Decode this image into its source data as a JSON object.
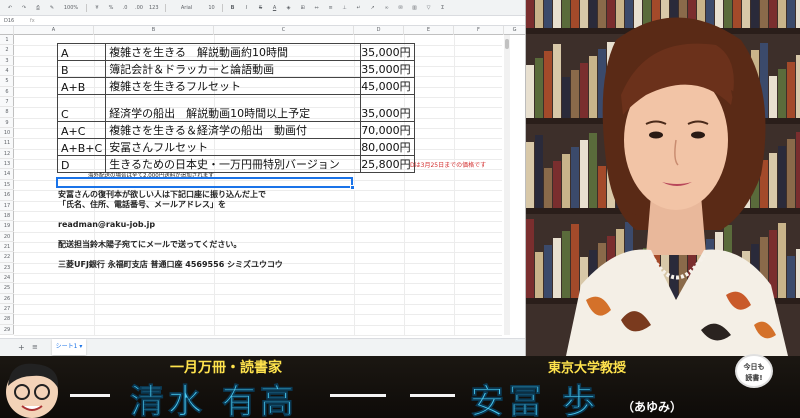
{
  "toolbar": {
    "zoom": "100%",
    "currency": "¥",
    "percent": "%",
    "decimals": ".0",
    "decimals_more": ".00",
    "format": "123",
    "font": "Arial",
    "font_size": "10"
  },
  "formula_bar": {
    "cell_ref": "D16",
    "fx": "fx"
  },
  "columns": [
    "A",
    "B",
    "C",
    "D",
    "E",
    "F",
    "G"
  ],
  "rows": [
    "1",
    "2",
    "3",
    "4",
    "5",
    "6",
    "7",
    "8",
    "9",
    "10",
    "11",
    "12",
    "13",
    "14",
    "15",
    "16",
    "17",
    "18",
    "19",
    "20",
    "21",
    "22",
    "23",
    "24",
    "25",
    "26",
    "27",
    "28",
    "29"
  ],
  "price_table": [
    {
      "code": "A",
      "desc": "複雑さを生きる　解説動画約10時間",
      "price": "35,000円"
    },
    {
      "code": "B",
      "desc": "簿記会計＆ドラッカーと論語動画",
      "price": "35,000円"
    },
    {
      "code": "A+B",
      "desc": "複雑さを生きるフルセット",
      "price": "45,000円"
    },
    {
      "code": "C",
      "desc": "経済学の船出　解説動画10時間以上予定",
      "price": "35,000円"
    },
    {
      "code": "A+C",
      "desc": "複雑さを生きる＆経済学の船出　動画付",
      "price": "70,000円"
    },
    {
      "code": "A+B+C",
      "desc": "安冨さんフルセット",
      "price": "80,000円"
    },
    {
      "code": "D",
      "desc": "生きるための日本史・一万円冊特別バージョン",
      "price": "25,800円"
    }
  ],
  "side_note": "Dは3月25日までの価格です",
  "overseas_note": "海外配送の場合は全て2,000円送料が追加されます",
  "instructions": [
    "安冨さんの復刊本が欲しい人は下記口座に振り込んだ上で",
    "「氏名、住所、電話番号、メールアドレス」を",
    "",
    "readman@raku-job.jp",
    "",
    "配送担当鈴木陽子宛てにメールで送ってください。",
    "",
    "三菱UFJ銀行 永福町支店 普通口座 4569556 シミズユウコウ"
  ],
  "sheet_tabs": {
    "add": "+",
    "list": "≡",
    "active": "シート1 ▾"
  },
  "banner": {
    "left_caption": "一月万冊・読書家",
    "left_name": "清水 有高",
    "right_caption": "東京大学教授",
    "right_name": "安冨 歩",
    "right_reading": "（あゆみ）",
    "badge_lines": [
      "今日も",
      "読書!"
    ]
  },
  "colors": {
    "sheet_bg": "#ffffff",
    "caption_yellow": "#ffe34d",
    "name_blue": "#48c8f0",
    "note_red": "#d32f2f",
    "selection_blue": "#1a73e8"
  }
}
